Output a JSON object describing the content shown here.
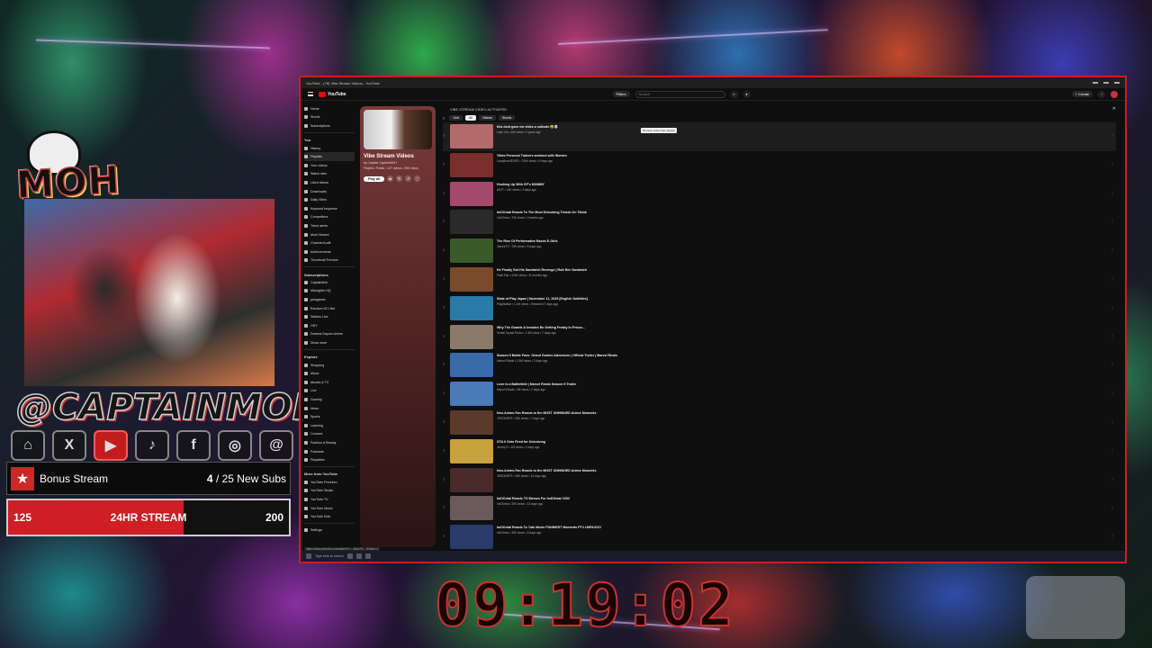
{
  "overlay": {
    "logo_text": "MOH",
    "handle": "@CAPTAINMOH",
    "socials": [
      {
        "icon": "twitch-icon",
        "glyph": "⌂"
      },
      {
        "icon": "x-icon",
        "glyph": "X"
      },
      {
        "icon": "youtube-icon",
        "glyph": "▶"
      },
      {
        "icon": "tiktok-icon",
        "glyph": "♪"
      },
      {
        "icon": "facebook-icon",
        "glyph": "f"
      },
      {
        "icon": "instagram-icon",
        "glyph": "◎"
      },
      {
        "icon": "threads-icon",
        "glyph": "@"
      }
    ],
    "goal": {
      "title": "Bonus Stream",
      "current": "4",
      "separator": " / ",
      "target_label": "25 New Subs"
    },
    "sub_bar": {
      "left_value": "125",
      "center_label": "24HR STREAM",
      "right_value": "200",
      "progress_fraction": 0.625
    },
    "clock": "09:19:02"
  },
  "browser": {
    "tab_title": "YouTube - (78) Vibe Stream Videos - YouTube",
    "header": {
      "logo": "YouTube",
      "filters_label": "Filters",
      "search_placeholder": "Search",
      "create_label": "+ Create"
    },
    "sidebar": {
      "top": [
        {
          "label": "Home",
          "icon": "home-icon"
        },
        {
          "label": "Shorts",
          "icon": "shorts-icon"
        },
        {
          "label": "Subscriptions",
          "icon": "subscriptions-icon"
        }
      ],
      "you_header": "You",
      "you": [
        {
          "label": "History",
          "icon": "history-icon"
        },
        {
          "label": "Playlists",
          "icon": "playlists-icon",
          "active": true
        },
        {
          "label": "Your videos",
          "icon": "your-videos-icon"
        },
        {
          "label": "Watch later",
          "icon": "watch-later-icon"
        },
        {
          "label": "Liked videos",
          "icon": "liked-icon"
        },
        {
          "label": "Downloads",
          "icon": "downloads-icon"
        },
        {
          "label": "Daily Vibes",
          "icon": "playlist-icon"
        },
        {
          "label": "Keyword Inspector",
          "icon": "playlist-icon"
        },
        {
          "label": "Competitors",
          "icon": "playlist-icon"
        },
        {
          "label": "Trend alerts",
          "icon": "playlist-icon"
        },
        {
          "label": "Most Viewed",
          "icon": "playlist-icon"
        },
        {
          "label": "Channel Audit",
          "icon": "playlist-icon"
        },
        {
          "label": "Achievements",
          "icon": "playlist-icon"
        },
        {
          "label": "Thumbnail Preview",
          "icon": "playlist-icon"
        }
      ],
      "subs_header": "Subscriptions",
      "subs": [
        {
          "label": "CaptainMoh",
          "icon": "channel-avatar-icon"
        },
        {
          "label": "Midnight's HQ",
          "icon": "channel-avatar-icon"
        },
        {
          "label": "pewgamer",
          "icon": "channel-avatar-icon"
        },
        {
          "label": "Random DCI Bot",
          "icon": "channel-avatar-icon"
        },
        {
          "label": "Stables Live",
          "icon": "channel-avatar-icon"
        },
        {
          "label": "GRY",
          "icon": "channel-avatar-icon"
        },
        {
          "label": "Darkest Dayum Anime",
          "icon": "channel-avatar-icon"
        },
        {
          "label": "Show more",
          "icon": "chevron-down-icon"
        }
      ],
      "explore_header": "Explore",
      "explore": [
        {
          "label": "Shopping",
          "icon": "shopping-icon"
        },
        {
          "label": "Music",
          "icon": "music-icon"
        },
        {
          "label": "Movies & TV",
          "icon": "movies-icon"
        },
        {
          "label": "Live",
          "icon": "live-icon"
        },
        {
          "label": "Gaming",
          "icon": "gaming-icon"
        },
        {
          "label": "News",
          "icon": "news-icon"
        },
        {
          "label": "Sports",
          "icon": "sports-icon"
        },
        {
          "label": "Learning",
          "icon": "learning-icon"
        },
        {
          "label": "Courses",
          "icon": "courses-icon"
        },
        {
          "label": "Fashion & Beauty",
          "icon": "fashion-icon"
        },
        {
          "label": "Podcasts",
          "icon": "podcasts-icon"
        },
        {
          "label": "Playables",
          "icon": "playables-icon"
        }
      ],
      "more_header": "More from YouTube",
      "more": [
        {
          "label": "YouTube Premium",
          "icon": "yt-premium-icon"
        },
        {
          "label": "YouTube Studio",
          "icon": "yt-studio-icon"
        },
        {
          "label": "YouTube TV",
          "icon": "yt-tv-icon"
        },
        {
          "label": "YouTube Music",
          "icon": "yt-music-icon"
        },
        {
          "label": "YouTube Kids",
          "icon": "yt-kids-icon"
        }
      ],
      "settings_label": "Settings"
    },
    "playlist": {
      "title": "Vibe Stream Videos",
      "owner": "by Captain CaptainMOH",
      "meta": "Playlist • Public • 127 videos • 890 views",
      "play_all": "Play all"
    },
    "list": {
      "topbar_title": "VIBE STREAM VIDEO ACTIVATED",
      "chips": [
        "Sort",
        "All",
        "Videos",
        "Shorts"
      ],
      "active_chip": "All",
      "tooltip": "Remove video from playlist",
      "videos": [
        {
          "title": "this dont gave me vides a soticate 😩💀",
          "meta": "Lash Vio • 460 views • 2 years ago",
          "thumb": "#b46a6a"
        },
        {
          "title": "Vibes Personal Trainers workout with Women",
          "meta": "LizzyBear4EVER • 700K views • 9 days ago",
          "thumb": "#7a2e2e"
        },
        {
          "title": "Hooking Up With GF's MOMMY",
          "meta": "ARJT • 44K views • 3 days ago",
          "thumb": "#a34a6a"
        },
        {
          "title": "ImDOntai Reacts To The Most Disturbing Trends On Tiktok",
          "meta": "ImDOntai • 70K views • 3 weeks ago",
          "thumb": "#2a2a2a"
        },
        {
          "title": "The Rise Of Performative Racist E-Girls",
          "meta": "JamesTV • 75K views • 9 days ago",
          "thumb": "#3a5a2a"
        },
        {
          "title": "He Finally Got His Sandwich Revenge | Rutt Rev Sandwich",
          "meta": "Pakii Fair • 410K views • 11 months ago",
          "thumb": "#7a4a2a"
        },
        {
          "title": "State of Play Japan | November 11, 2025 [English Subtitles]",
          "meta": "PlayStation • 1.1M views • Streamed 7 days ago",
          "thumb": "#2a7aa8"
        },
        {
          "title": "Why The Guards & Inmates Be Getting Freaky In Prison...",
          "meta": "Verbal Squad Pedro • 1.3M views • 7 days ago",
          "thumb": "#8a7a6a"
        },
        {
          "title": "Season 5 Battle Pass: Grand Garden Adventure | Official Trailer | Marvel Rivals",
          "meta": "Marvel Rivals • 1.6M views • 2 days ago",
          "thumb": "#3a6aa8"
        },
        {
          "title": "Love is a Battlefield | Marvel Rivals Season 5 Trailer",
          "meta": "Marvel Rivals • 2M views • 2 days ago",
          "thumb": "#4a7ab8"
        },
        {
          "title": "Non-Anime-Fan Reacts to the MOST UNHINGED Anime Moments",
          "meta": "JRSONGRT • 28K views • 7 days ago",
          "thumb": "#5a3a2a"
        },
        {
          "title": "GTA 6 Gets Fired for Unionizing",
          "meta": "Jimmy71 • 1M views • 2 days ago",
          "thumb": "#c8a23a"
        },
        {
          "title": "Non-Anime-Fan Reacts to the MOST UNHINGED Anime Moments",
          "meta": "JRSONGRT • 28K views • 10 days ago",
          "thumb": "#4a2a2a"
        },
        {
          "title": "ImDOntai Reacts TO Memes For ImDOntai V202",
          "meta": "ImDOntai • 28K views • 13 days ago",
          "thumb": "#6a5a5a"
        },
        {
          "title": "ImDOntai Reacts To Tubi Movie FUNNIEST Moments PT4 LMFAOOO",
          "meta": "ImDOntai • 35K views • 6 days ago",
          "thumb": "#2a3a6a"
        }
      ]
    },
    "status_url": "https://www.youtube.com/watch?v=...&list=PL...&index=1",
    "taskbar_search": "Type here to search"
  }
}
